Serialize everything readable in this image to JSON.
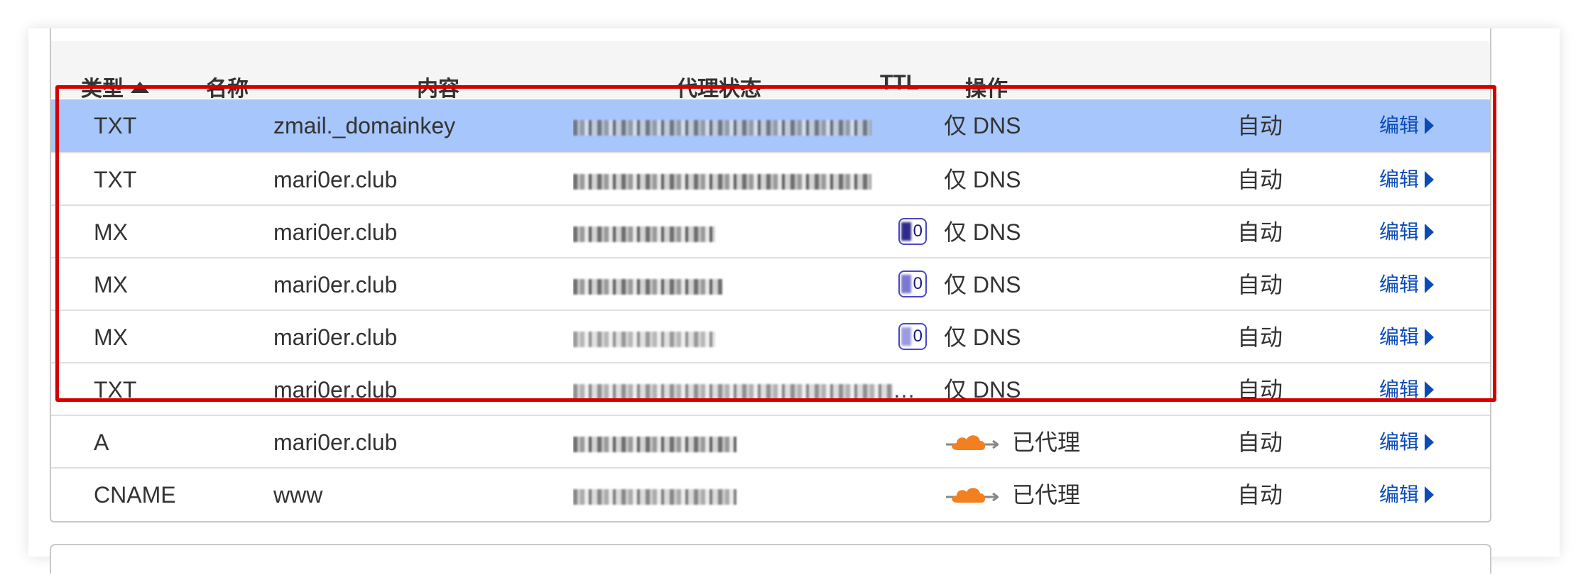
{
  "table": {
    "headers": {
      "type": "类型",
      "name": "名称",
      "content": "内容",
      "proxy_status": "代理状态",
      "ttl": "TTL",
      "actions": "操作"
    },
    "sort": {
      "column": "type",
      "direction": "ascending"
    },
    "rows": [
      {
        "type": "TXT",
        "name": "zmail._domainkey",
        "proxy": "仅 DNS",
        "ttl": "自动",
        "action": "编辑",
        "selected": true,
        "proxied": false
      },
      {
        "type": "TXT",
        "name": "mari0er.club",
        "proxy": "仅 DNS",
        "ttl": "自动",
        "action": "编辑",
        "proxied": false
      },
      {
        "type": "MX",
        "name": "mari0er.club",
        "priority": "0",
        "proxy": "仅 DNS",
        "ttl": "自动",
        "action": "编辑",
        "proxied": false
      },
      {
        "type": "MX",
        "name": "mari0er.club",
        "priority": "0",
        "proxy": "仅 DNS",
        "ttl": "自动",
        "action": "编辑",
        "proxied": false
      },
      {
        "type": "MX",
        "name": "mari0er.club",
        "priority": "0",
        "proxy": "仅 DNS",
        "ttl": "自动",
        "action": "编辑",
        "proxied": false
      },
      {
        "type": "TXT",
        "name": "mari0er.club",
        "proxy": "仅 DNS",
        "ttl": "自动",
        "action": "编辑",
        "content_ellipsis": "…",
        "proxied": false
      },
      {
        "type": "A",
        "name": "mari0er.club",
        "proxy": "已代理",
        "ttl": "自动",
        "action": "编辑",
        "proxied": true
      },
      {
        "type": "CNAME",
        "name": "www",
        "proxy": "已代理",
        "ttl": "自动",
        "action": "编辑",
        "proxied": true
      }
    ]
  },
  "icons": {
    "sort": "triangle-up-icon",
    "action_caret": "caret-right-icon",
    "proxied": "orange-cloud-icon"
  },
  "colors": {
    "selected_row": "#a7c7fc",
    "link": "#0b4bb8",
    "highlight_box": "#d40000",
    "cloud": "#f38020",
    "priority_badge": "#4a48c6"
  }
}
